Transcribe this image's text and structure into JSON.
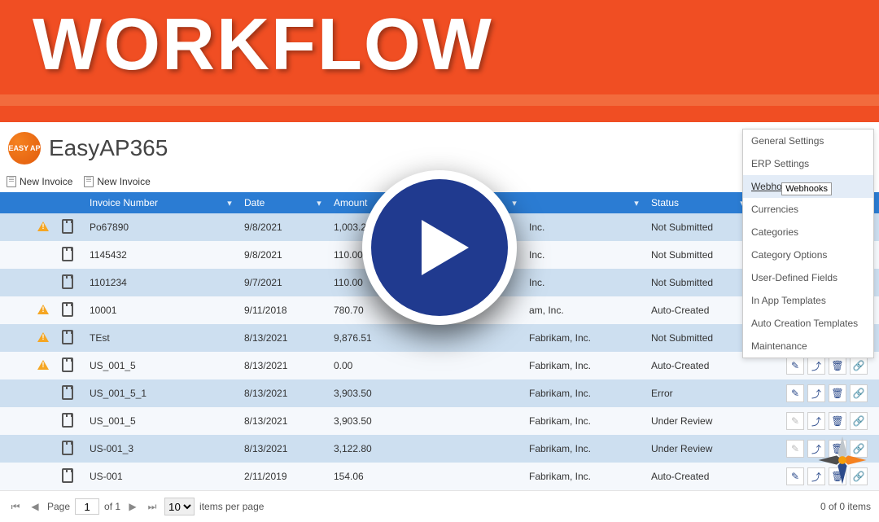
{
  "banner": {
    "title": "WORKFLOW"
  },
  "app": {
    "title": "EasyAP365",
    "logo_text": "EASY AP"
  },
  "toolbar": {
    "newInvoice": "New Invoice",
    "newInvoice2": "New Invoice"
  },
  "settingsMenu": {
    "items": [
      {
        "label": "General Settings"
      },
      {
        "label": "ERP Settings"
      },
      {
        "label": "Webhooks",
        "highlighted": true
      },
      {
        "label": "Currencies"
      },
      {
        "label": "Categories"
      },
      {
        "label": "Category Options"
      },
      {
        "label": "User-Defined Fields"
      },
      {
        "label": "In App Templates"
      },
      {
        "label": "Auto Creation Templates"
      },
      {
        "label": "Maintenance"
      }
    ],
    "tooltip": "Webhooks"
  },
  "grid": {
    "columns": {
      "invoice": "Invoice Number",
      "date": "Date",
      "amount": "Amount",
      "vendor": "",
      "status": "Status"
    },
    "rows": [
      {
        "warn": true,
        "invoice": "Po67890",
        "date": "9/8/2021",
        "amount": "1,003.25",
        "vendor": "Inc.",
        "status": "Not Submitted",
        "actions": [
          "edit"
        ]
      },
      {
        "warn": false,
        "invoice": "1145432",
        "date": "9/8/2021",
        "amount": "110.00",
        "vendor": "Inc.",
        "status": "Not Submitted",
        "actions": [
          "edit"
        ]
      },
      {
        "warn": false,
        "invoice": "1101234",
        "date": "9/7/2021",
        "amount": "110.00",
        "vendor": "Inc.",
        "status": "Not Submitted",
        "actions": [
          "edit"
        ]
      },
      {
        "warn": true,
        "invoice": "10001",
        "date": "9/11/2018",
        "amount": "780.70",
        "vendor": "am, Inc.",
        "status": "Auto-Created",
        "actions": [
          "edit",
          "up",
          "del",
          "link"
        ]
      },
      {
        "warn": true,
        "invoice": "TEst",
        "date": "8/13/2021",
        "amount": "9,876.51",
        "vendor": "Fabrikam, Inc.",
        "status": "Not Submitted",
        "actions": [
          "edit",
          "up",
          "del",
          "link-d"
        ]
      },
      {
        "warn": true,
        "invoice": "US_001_5",
        "date": "8/13/2021",
        "amount": "0.00",
        "vendor": "Fabrikam, Inc.",
        "status": "Auto-Created",
        "actions": [
          "edit",
          "up",
          "del",
          "link"
        ]
      },
      {
        "warn": false,
        "invoice": "US_001_5_1",
        "date": "8/13/2021",
        "amount": "3,903.50",
        "vendor": "Fabrikam, Inc.",
        "status": "Error",
        "actions": [
          "edit",
          "up",
          "del",
          "link"
        ]
      },
      {
        "warn": false,
        "invoice": "US_001_5",
        "date": "8/13/2021",
        "amount": "3,903.50",
        "vendor": "Fabrikam, Inc.",
        "status": "Under Review",
        "actions": [
          "edit-d",
          "up",
          "del",
          "link"
        ]
      },
      {
        "warn": false,
        "invoice": "US-001_3",
        "date": "8/13/2021",
        "amount": "3,122.80",
        "vendor": "Fabrikam, Inc.",
        "status": "Under Review",
        "actions": [
          "edit-d",
          "up",
          "del",
          "link"
        ]
      },
      {
        "warn": false,
        "invoice": "US-001",
        "date": "2/11/2019",
        "amount": "154.06",
        "vendor": "Fabrikam, Inc.",
        "status": "Auto-Created",
        "actions": [
          "edit",
          "up",
          "del",
          "link"
        ]
      }
    ]
  },
  "pager": {
    "pageLabel": "Page",
    "pageValue": "1",
    "ofLabel": "of 1",
    "perPage": "10",
    "itemsPerPage": "items per page",
    "itemsLabel": "0 of 0 items"
  }
}
